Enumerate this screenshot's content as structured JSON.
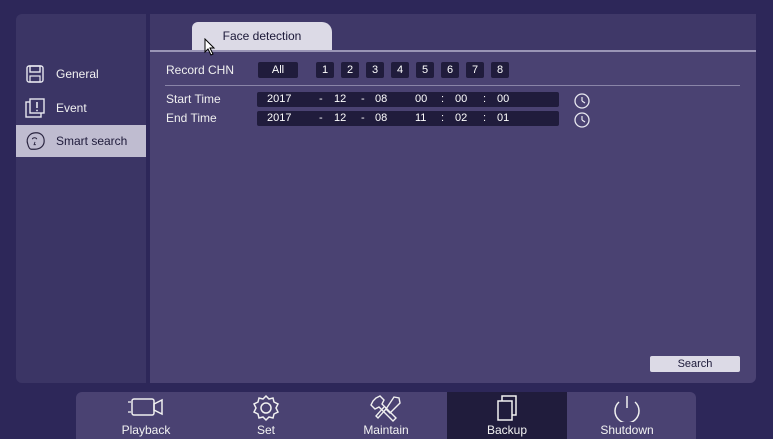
{
  "sidebar": {
    "items": [
      {
        "label": "General",
        "icon": "save-icon"
      },
      {
        "label": "Event",
        "icon": "event-icon"
      },
      {
        "label": "Smart search",
        "icon": "face-icon"
      }
    ]
  },
  "main": {
    "tab_label": "Face detection",
    "record_chn_label": "Record CHN",
    "all_label": "All",
    "channels": [
      "1",
      "2",
      "3",
      "4",
      "5",
      "6",
      "7",
      "8"
    ],
    "start_time_label": "Start Time",
    "end_time_label": "End Time",
    "start": {
      "year": "2017",
      "month": "12",
      "day": "08",
      "hour": "00",
      "minute": "00",
      "second": "00"
    },
    "end": {
      "year": "2017",
      "month": "12",
      "day": "08",
      "hour": "11",
      "minute": "02",
      "second": "01"
    },
    "dash": "-",
    "colon": ":",
    "search_label": "Search"
  },
  "bottombar": {
    "items": [
      {
        "label": "Playback",
        "icon": "camera-icon"
      },
      {
        "label": "Set",
        "icon": "gear-icon"
      },
      {
        "label": "Maintain",
        "icon": "tools-icon"
      },
      {
        "label": "Backup",
        "icon": "copy-icon"
      },
      {
        "label": "Shutdown",
        "icon": "power-icon"
      }
    ],
    "active": "Backup"
  },
  "colors": {
    "background": "#2d2759",
    "panel": "#4a4272",
    "field": "#201c3c",
    "active_item": "#bfbcd0"
  }
}
